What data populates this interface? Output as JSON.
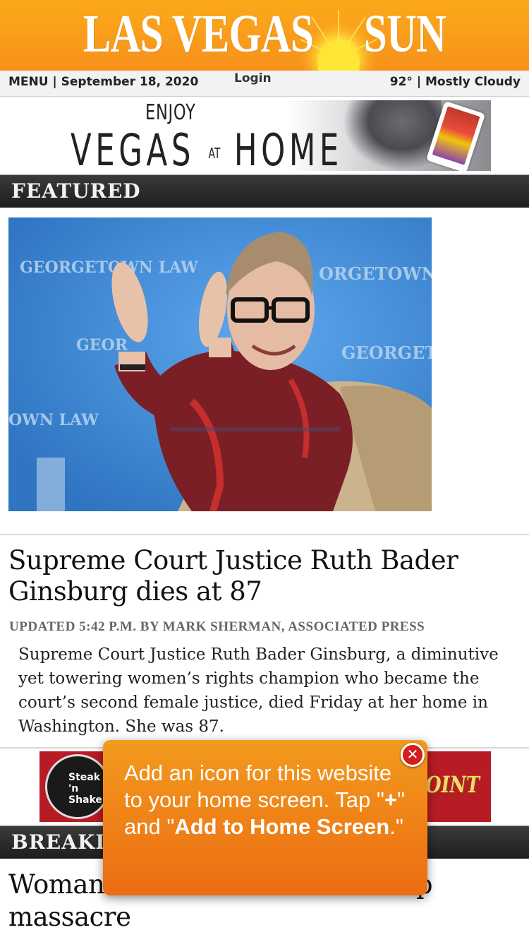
{
  "masthead": {
    "word1": "LAS VEGAS",
    "word2": "SUN",
    "colors": {
      "background": "#f7931e",
      "text": "#ffffff"
    }
  },
  "infobar": {
    "menu_label": "MENU",
    "date": "September 18, 2020",
    "login_label": "Login",
    "temperature": "92°",
    "conditions": "Mostly Cloudy"
  },
  "top_ad": {
    "line1": "ENJOY",
    "word_vegas": "VEGAS",
    "word_at": "AT",
    "word_home": "HOME"
  },
  "featured": {
    "section_label": "FEATURED",
    "headline": "Supreme Court Justice Ruth Bader Ginsburg dies at 87",
    "byline": "UPDATED 5:42 P.M. BY MARK SHERMAN, ASSOCIATED PRESS",
    "summary": "Supreme Court Justice Ruth Bader Ginsburg, a diminutive yet towering women’s rights champion who became the court’s second female justice, died Friday at her home in Washington. She was 87.",
    "photo_backdrop_words": [
      "GEORGETOWN LAW",
      "ORGETOWN",
      "GEOR",
      "GEORGET",
      "OWN LAW"
    ]
  },
  "bottom_ad": {
    "logo_text": [
      "Steak",
      "'n",
      "Shake"
    ],
    "right_text": "POINT"
  },
  "breaking": {
    "section_label": "BREAKING NEWS",
    "headline": "Woman ... found from 2017 Strip massacre"
  },
  "popup": {
    "text_1": "Add an icon for this website to your home screen. Tap \"",
    "plus": "+",
    "text_2": "\" and \"",
    "action": "Add to Home Screen",
    "text_3": ".\"",
    "close_symbol": "✕"
  }
}
